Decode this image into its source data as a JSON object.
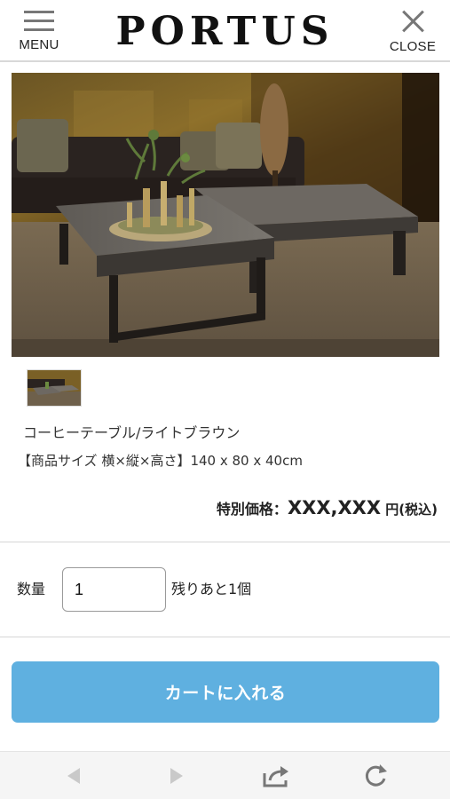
{
  "header": {
    "menu_label": "MENU",
    "logo": "PORTUS",
    "close_label": "CLOSE"
  },
  "product": {
    "name": "コーヒーテーブル/ライトブラウン",
    "size": "【商品サイズ 横×縦×高さ】140 x 80 x 40cm",
    "price_label": "特別価格：",
    "price_amount": "XXX,XXX",
    "price_unit": " 円(税込)"
  },
  "purchase": {
    "qty_label": "数量",
    "qty_value": "1",
    "stock_text": "残りあと1個",
    "cart_button": "カートに入れる"
  },
  "browser_toolbar": {
    "icons": [
      "back-icon",
      "forward-icon",
      "share-icon",
      "reload-icon"
    ]
  },
  "colors": {
    "cart_button": "#5fb0e0",
    "icon_gray": "#777777"
  }
}
